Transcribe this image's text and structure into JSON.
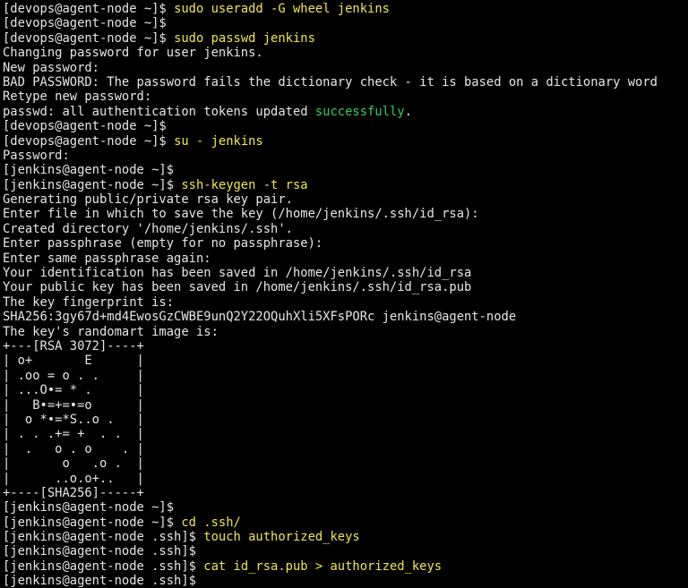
{
  "colors": {
    "background": "#000000",
    "text": "#e6e6e6",
    "command": "#f0e64a",
    "success": "#2fd05a"
  },
  "terminal": {
    "lines": [
      [
        {
          "t": "[devops@agent-node ~]$ ",
          "k": "prompt"
        },
        {
          "t": "sudo useradd -G wheel jenkins",
          "k": "cmd"
        }
      ],
      [
        {
          "t": "[devops@agent-node ~]$",
          "k": "prompt"
        }
      ],
      [
        {
          "t": "[devops@agent-node ~]$ ",
          "k": "prompt"
        },
        {
          "t": "sudo passwd jenkins",
          "k": "cmd"
        }
      ],
      [
        {
          "t": "Changing password for user jenkins.",
          "k": "out"
        }
      ],
      [
        {
          "t": "New password:",
          "k": "out"
        }
      ],
      [
        {
          "t": "BAD PASSWORD: The password fails the dictionary check - it is based on a dictionary word",
          "k": "out"
        }
      ],
      [
        {
          "t": "Retype new password:",
          "k": "out"
        }
      ],
      [
        {
          "t": "passwd: all authentication tokens updated ",
          "k": "out"
        },
        {
          "t": "successfully",
          "k": "ok"
        },
        {
          "t": ".",
          "k": "out"
        }
      ],
      [
        {
          "t": "[devops@agent-node ~]$",
          "k": "prompt"
        }
      ],
      [
        {
          "t": "[devops@agent-node ~]$ ",
          "k": "prompt"
        },
        {
          "t": "su - jenkins",
          "k": "cmd"
        }
      ],
      [
        {
          "t": "Password:",
          "k": "out"
        }
      ],
      [
        {
          "t": "[jenkins@agent-node ~]$",
          "k": "prompt"
        }
      ],
      [
        {
          "t": "[jenkins@agent-node ~]$ ",
          "k": "prompt"
        },
        {
          "t": "ssh-keygen -t rsa",
          "k": "cmd"
        }
      ],
      [
        {
          "t": "Generating public/private rsa key pair.",
          "k": "out"
        }
      ],
      [
        {
          "t": "Enter file in which to save the key (/home/jenkins/.ssh/id_rsa):",
          "k": "out"
        }
      ],
      [
        {
          "t": "Created directory '/home/jenkins/.ssh'.",
          "k": "out"
        }
      ],
      [
        {
          "t": "Enter passphrase (empty for no passphrase):",
          "k": "out"
        }
      ],
      [
        {
          "t": "Enter same passphrase again:",
          "k": "out"
        }
      ],
      [
        {
          "t": "Your identification has been saved in /home/jenkins/.ssh/id_rsa",
          "k": "out"
        }
      ],
      [
        {
          "t": "Your public key has been saved in /home/jenkins/.ssh/id_rsa.pub",
          "k": "out"
        }
      ],
      [
        {
          "t": "The key fingerprint is:",
          "k": "out"
        }
      ],
      [
        {
          "t": "SHA256:3gy67d+md4EwosGzCWBE9unQ2Y22OQuhXli5XFsPORc jenkins@agent-node",
          "k": "out"
        }
      ],
      [
        {
          "t": "The key's randomart image is:",
          "k": "out"
        }
      ],
      [
        {
          "t": "+---[RSA 3072]----+",
          "k": "out"
        }
      ],
      [
        {
          "t": "| o+       E      |",
          "k": "out"
        }
      ],
      [
        {
          "t": "| .oo = o . .     |",
          "k": "out"
        }
      ],
      [
        {
          "t": "| ...O•= * .      |",
          "k": "out"
        }
      ],
      [
        {
          "t": "|   B•=+=•=o      |",
          "k": "out"
        }
      ],
      [
        {
          "t": "|  o *•=*S..o .   |",
          "k": "out"
        }
      ],
      [
        {
          "t": "| . . .+= +  . .  |",
          "k": "out"
        }
      ],
      [
        {
          "t": "|  .   o . o    . |",
          "k": "out"
        }
      ],
      [
        {
          "t": "|       o   .o .  |",
          "k": "out"
        }
      ],
      [
        {
          "t": "|      ..o.o+..   |",
          "k": "out"
        }
      ],
      [
        {
          "t": "+----[SHA256]-----+",
          "k": "out"
        }
      ],
      [
        {
          "t": "[jenkins@agent-node ~]$",
          "k": "prompt"
        }
      ],
      [
        {
          "t": "[jenkins@agent-node ~]$ ",
          "k": "prompt"
        },
        {
          "t": "cd .ssh/",
          "k": "cmd"
        }
      ],
      [
        {
          "t": "[jenkins@agent-node .ssh]$ ",
          "k": "prompt"
        },
        {
          "t": "touch authorized_keys",
          "k": "cmd"
        }
      ],
      [
        {
          "t": "[jenkins@agent-node .ssh]$",
          "k": "prompt"
        }
      ],
      [
        {
          "t": "[jenkins@agent-node .ssh]$ ",
          "k": "prompt"
        },
        {
          "t": "cat id_rsa.pub > authorized_keys",
          "k": "cmd"
        }
      ],
      [
        {
          "t": "[jenkins@agent-node .ssh]$",
          "k": "prompt"
        }
      ]
    ]
  }
}
